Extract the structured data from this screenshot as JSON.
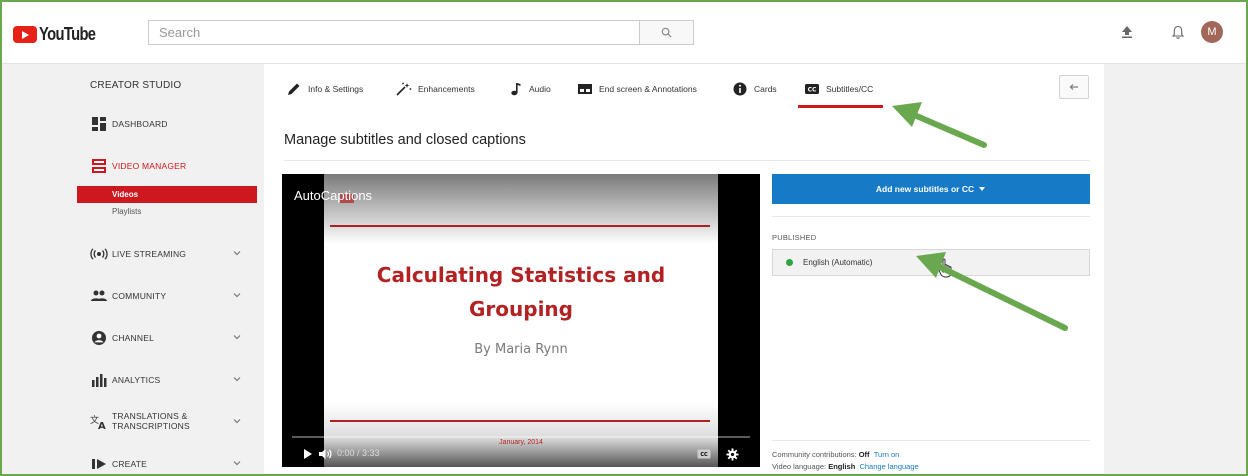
{
  "header": {
    "logo_text": "YouTube",
    "search_placeholder": "Search",
    "avatar_initial": "M"
  },
  "sidebar": {
    "title": "CREATOR STUDIO",
    "dashboard": "DASHBOARD",
    "video_manager": "VIDEO MANAGER",
    "sub_videos": "Videos",
    "sub_playlists": "Playlists",
    "live_streaming": "LIVE STREAMING",
    "community": "COMMUNITY",
    "channel": "CHANNEL",
    "analytics": "ANALYTICS",
    "translations_1": "TRANSLATIONS &",
    "translations_2": "TRANSCRIPTIONS",
    "create": "CREATE"
  },
  "tabs": {
    "info": "Info & Settings",
    "enhancements": "Enhancements",
    "audio": "Audio",
    "end_screen": "End screen & Annotations",
    "cards": "Cards",
    "subtitles": "Subtitles/CC"
  },
  "main": {
    "title": "Manage subtitles and closed captions"
  },
  "video": {
    "title": "AutoCaptions",
    "slide_title_1": "Calculating Statistics and",
    "slide_title_2": "Grouping",
    "slide_author": "By Maria Rynn",
    "slide_date": "January, 2014",
    "time": "0:00 / 3:33"
  },
  "subtitles": {
    "add_button": "Add new subtitles or CC",
    "published_label": "PUBLISHED",
    "track_name": "English (Automatic)",
    "contrib_label": "Community contributions:",
    "contrib_value": "Off",
    "contrib_link": "Turn on",
    "language_label": "Video language:",
    "language_value": "English",
    "language_link": "Change language"
  },
  "colors": {
    "accent_red": "#cc181e",
    "button_blue": "#167ac6",
    "annotation_green": "#6aa84f"
  }
}
